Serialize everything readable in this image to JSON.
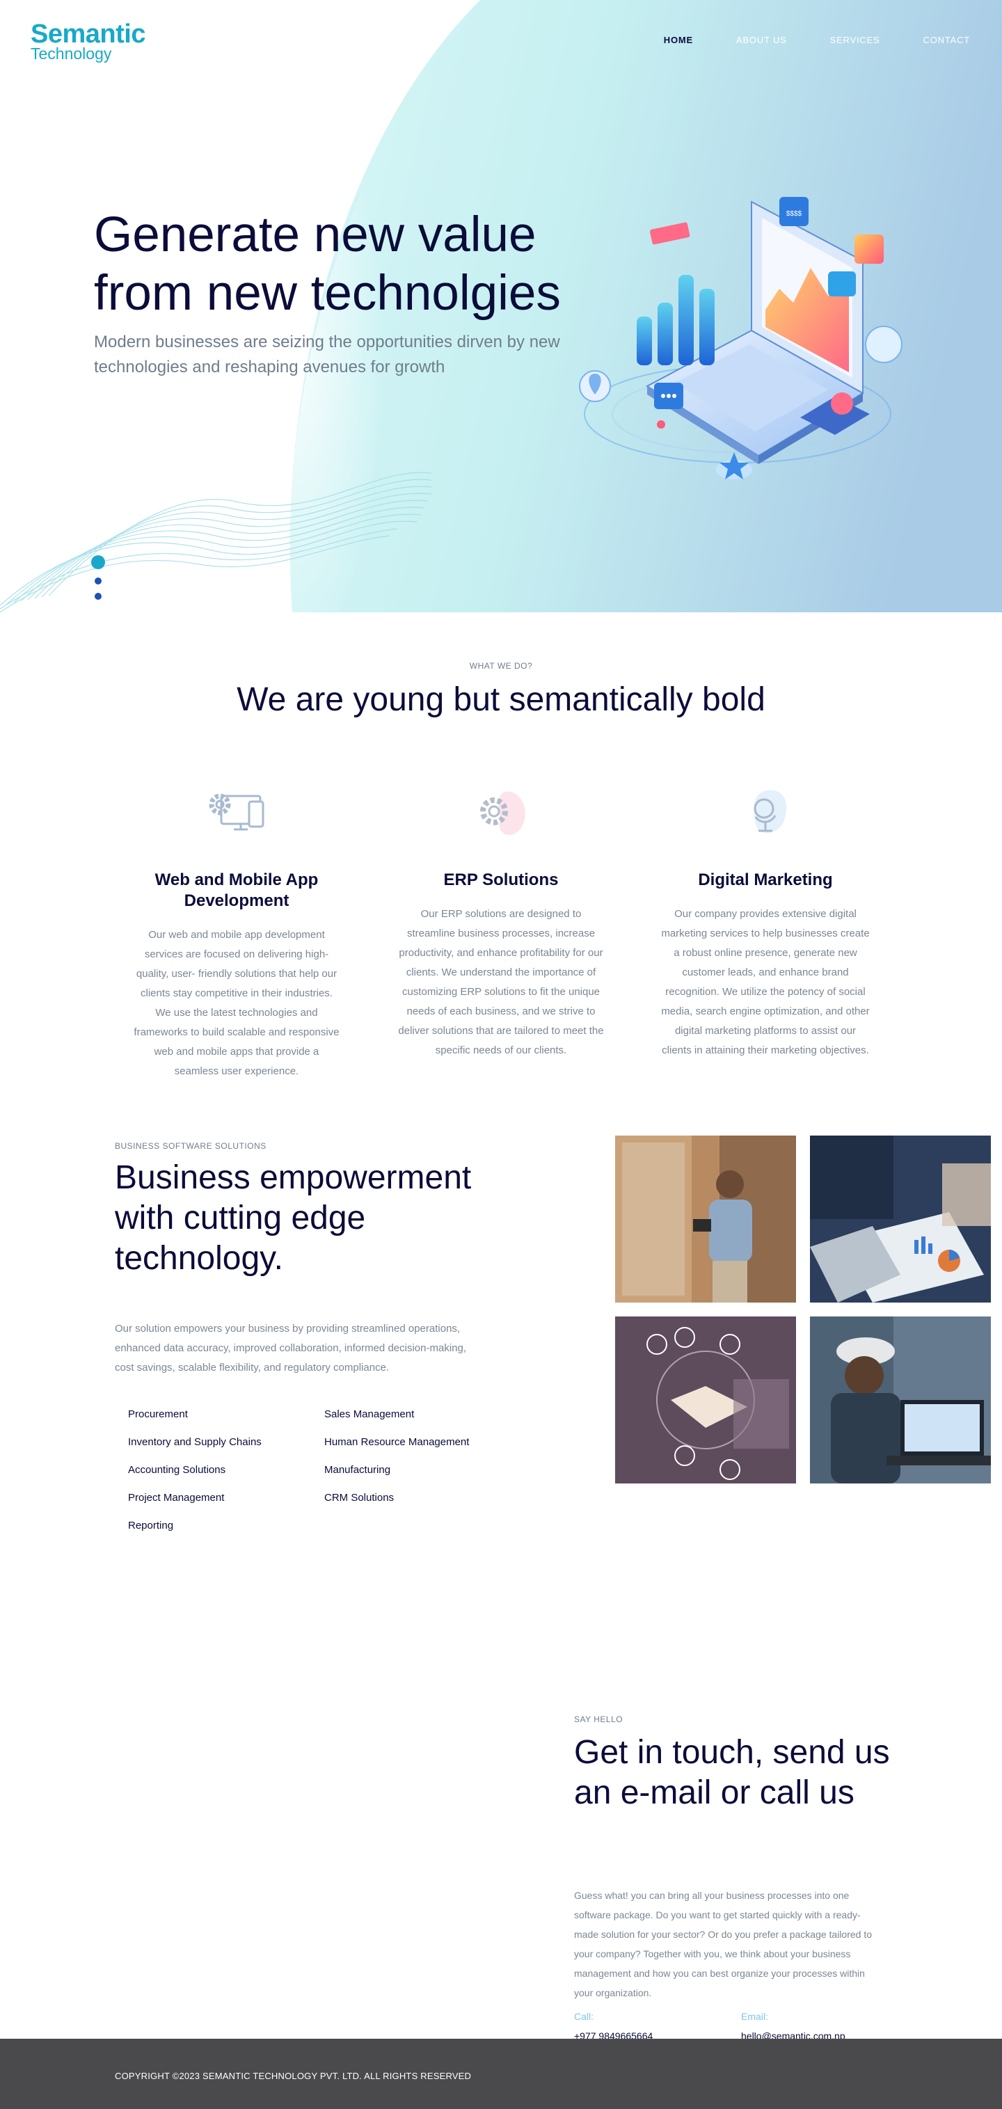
{
  "brand": {
    "name_line1": "Semantic",
    "name_line2": "Technology",
    "accent": "#17a9c8",
    "navy": "#0b0c3a"
  },
  "nav": [
    {
      "label": "HOME",
      "active": true
    },
    {
      "label": "ABOUT US",
      "active": false
    },
    {
      "label": "SERVICES",
      "active": false
    },
    {
      "label": "CONTACT",
      "active": false
    }
  ],
  "hero": {
    "title": "Generate new value from new technolgies",
    "subtitle": "Modern businesses are seizing the opportunities dirven by new technologies and reshaping avenues for growth",
    "slider": {
      "slides": 3,
      "active_index": 0
    },
    "illustration": {
      "badge_text": "$$$$"
    }
  },
  "services": {
    "eyebrow": "WHAT WE DO?",
    "title": "We are young but semantically bold",
    "items": [
      {
        "icon": "devices-gear-icon",
        "title": "Web and Mobile App Development",
        "text": "Our web and mobile app development services are focused on delivering high-quality, user- friendly solutions that help our clients stay competitive in their industries. We use the latest technologies and frameworks to build scalable and responsive web and mobile apps that provide a seamless user experience."
      },
      {
        "icon": "gear-icon",
        "title": "ERP Solutions",
        "text": "Our ERP solutions are designed to streamline business processes, increase productivity, and enhance profitability for our clients. We understand the importance of customizing ERP solutions to fit the unique needs of each business, and we strive to deliver solutions that are tailored to meet the specific needs of our clients."
      },
      {
        "icon": "globe-icon",
        "title": "Digital Marketing",
        "text": "Our company provides extensive digital marketing services to help businesses create a robust online presence, generate new customer leads, and enhance brand recognition. We utilize the potency of social media, search engine optimization, and other digital marketing platforms to assist our clients in attaining their marketing objectives."
      }
    ]
  },
  "business": {
    "eyebrow": "BUSINESS SOFTWARE SOLUTIONS",
    "title": "Business empowerment with cutting edge technology.",
    "description": "Our solution empowers your business by providing streamlined operations, enhanced data accuracy, improved collaboration, informed decision-making, cost savings, scalable flexibility, and regulatory compliance.",
    "modules": [
      "Procurement",
      "Sales Management",
      "Inventory and Supply Chains",
      "Human Resource Management",
      "Accounting Solutions",
      "Manufacturing",
      "Project Management",
      "CRM Solutions",
      "Reporting"
    ],
    "photos": [
      "warehouse-photo",
      "business-charts-photo",
      "teamwork-hands-photo",
      "engineer-laptop-photo"
    ]
  },
  "contact": {
    "eyebrow": "SAY HELLO",
    "title": "Get in touch, send us an e-mail or call us",
    "body": "Guess what! you can bring all your business processes into one software package. Do you want to get started quickly with a ready-made solution for your sector? Or do you prefer a package tailored to your company? Together with you, we think about your business management and how you can best organize your processes within your organization.",
    "call_label": "Call:",
    "call_value": "+977 9849665664",
    "email_label": "Email:",
    "email_value": "hello@semantic.com.np"
  },
  "footer": {
    "copyright": "COPYRIGHT ©2023 SEMANTIC TECHNOLOGY PVT. LTD. ALL RIGHTS RESERVED"
  }
}
